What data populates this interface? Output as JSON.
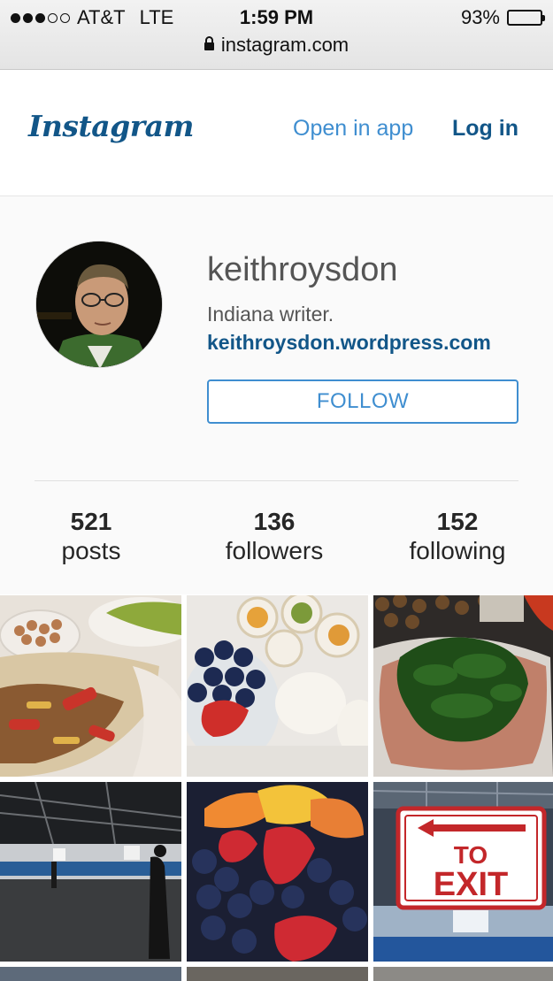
{
  "status_bar": {
    "carrier": "AT&T",
    "network": "LTE",
    "time": "1:59 PM",
    "battery": "93%",
    "battery_level": 0.93,
    "url": "instagram.com",
    "signal_bars": 3
  },
  "header": {
    "logo": "Instagram",
    "open_in_app": "Open in app",
    "log_in": "Log in"
  },
  "profile": {
    "username": "keithroysdon",
    "bio": "Indiana writer.",
    "website": "keithroysdon.wordpress.com",
    "follow_label": "FOLLOW"
  },
  "stats": [
    {
      "value": "521",
      "label": "posts"
    },
    {
      "value": "136",
      "label": "followers"
    },
    {
      "value": "152",
      "label": "following"
    }
  ],
  "grid": {
    "photos": [
      "pita-wrap-with-beans-photo",
      "blueberries-eggs-wraps-photo",
      "ham-with-spinach-photo",
      "empty-warehouse-photo",
      "fruit-bowl-photo",
      "to-exit-sign-photo"
    ],
    "exit_sign_text": [
      "TO",
      "EXIT"
    ]
  },
  "colors": {
    "link_blue": "#3f8ed0",
    "dark_blue": "#125688",
    "profile_bg": "#fafafa"
  }
}
